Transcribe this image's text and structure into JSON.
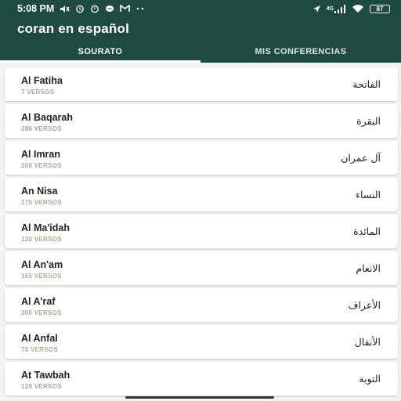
{
  "status_bar": {
    "time": "5:08 PM",
    "signal_label": "4G",
    "battery": "87",
    "icons": [
      "mute-icon",
      "alarm-icon",
      "alarm-icon-2",
      "chat-icon",
      "mail-icon",
      "more-dots-icon",
      "location-icon",
      "signal-icon",
      "wifi-icon",
      "battery-icon"
    ]
  },
  "app": {
    "title": "coran en español",
    "header_color": "#1f4a41"
  },
  "tabs": [
    {
      "label": "SOURATO",
      "active": true
    },
    {
      "label": "MIS CONFERENCIAS",
      "active": false
    }
  ],
  "surahs": [
    {
      "name": "Al Fatiha",
      "verses": "7 VERSOS",
      "arabic": "الفاتحة"
    },
    {
      "name": "Al Baqarah",
      "verses": "286 VERSOS",
      "arabic": "البقرة"
    },
    {
      "name": "Al Imran",
      "verses": "200 VERSOS",
      "arabic": "آل عمران"
    },
    {
      "name": "An Nisa",
      "verses": "176 VERSOS",
      "arabic": "النساء"
    },
    {
      "name": "Al Ma'idah",
      "verses": "120 VERSOS",
      "arabic": "المائدة"
    },
    {
      "name": "Al An'am",
      "verses": "165 VERSOS",
      "arabic": "الانعام"
    },
    {
      "name": "Al A'raf",
      "verses": "206 VERSOS",
      "arabic": "الأعراف"
    },
    {
      "name": "Al Anfal",
      "verses": "75 VERSOS",
      "arabic": "الأنفال"
    },
    {
      "name": "At Tawbah",
      "verses": "129 VERSOS",
      "arabic": "التوبة"
    }
  ]
}
